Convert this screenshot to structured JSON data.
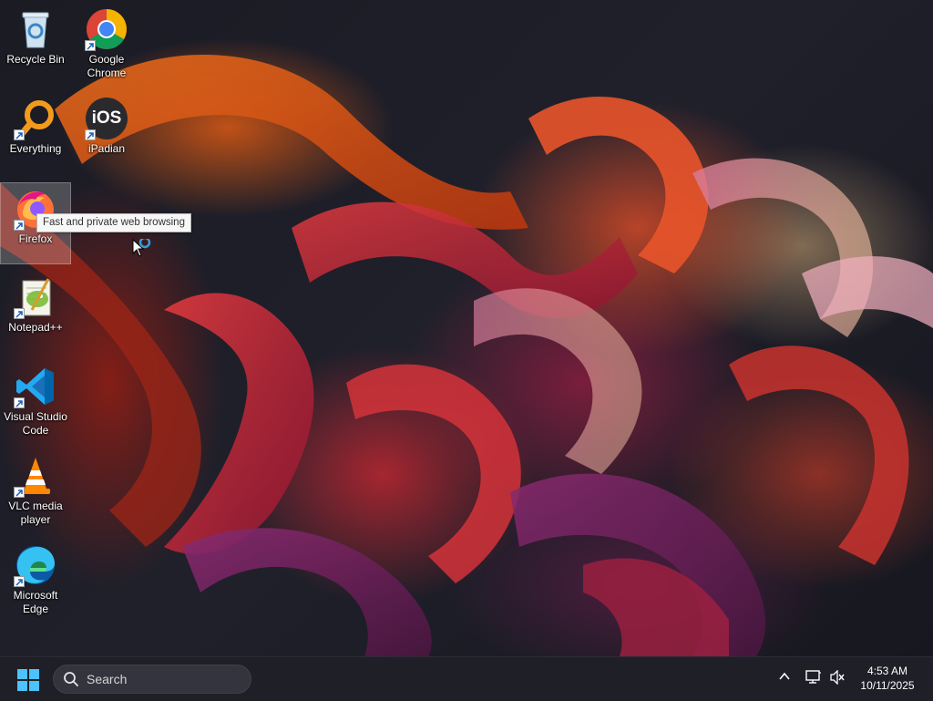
{
  "desktop": {
    "icons": [
      {
        "label": "Recycle Bin",
        "icon": "recycle-bin-icon"
      },
      {
        "label": "Google Chrome",
        "icon": "chrome-icon"
      },
      {
        "label": "Everything",
        "icon": "everything-search-icon"
      },
      {
        "label": "iPadian",
        "icon": "ipadian-ios-icon",
        "glyph": "iOS"
      },
      {
        "label": "Firefox",
        "icon": "firefox-icon",
        "selected": true
      },
      {
        "label": "Notepad++",
        "icon": "notepad-plus-plus-icon"
      },
      {
        "label": "Visual Studio Code",
        "icon": "vscode-icon"
      },
      {
        "label": "VLC media player",
        "icon": "vlc-icon"
      },
      {
        "label": "Microsoft Edge",
        "icon": "edge-icon"
      }
    ],
    "tooltip": "Fast and private web browsing"
  },
  "taskbar": {
    "start_icon": "windows-start-icon",
    "search_placeholder": "Search",
    "tray": {
      "overflow_icon": "chevron-up-icon",
      "network_icon": "network-icon",
      "volume_icon": "volume-muted-icon"
    },
    "clock": {
      "time": "4:53 AM",
      "date": "10/11/2025"
    }
  },
  "colors": {
    "taskbar_bg": "#1f1f27",
    "accent_blue": "#3a9bdc",
    "wallpaper_orange": "#e0561e",
    "wallpaper_red": "#c8283a"
  }
}
